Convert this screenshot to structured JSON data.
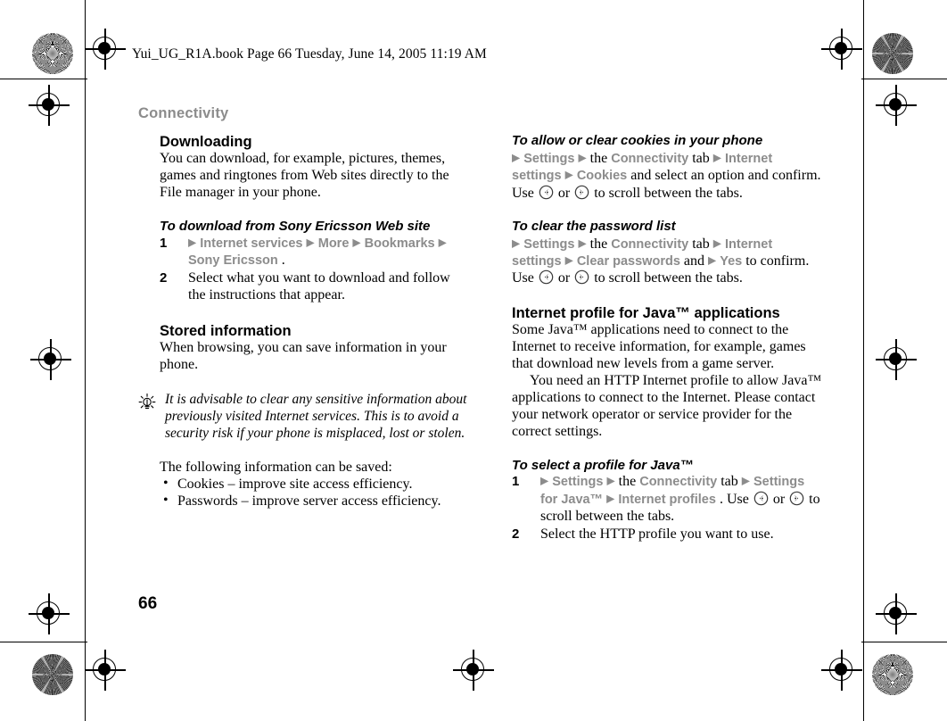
{
  "page": {
    "header_line": "Yui_UG_R1A.book  Page 66  Tuesday, June 14, 2005  11:19 AM",
    "chapter_title": "Connectivity",
    "page_number": "66",
    "gray_accent": "#8c8c8c",
    "arrow_glyph": "▶",
    "bullet_glyph": "•"
  },
  "left_column": {
    "downloading": {
      "heading": "Downloading",
      "body": "You can download, for example, pictures, themes, games and ringtones from Web sites directly to the File manager in your phone."
    },
    "download_sony": {
      "heading": "To download from Sony Ericsson Web site",
      "steps": [
        {
          "num": "1",
          "parts": [
            {
              "t": "arrow"
            },
            {
              "t": "menu",
              "v": "Internet services"
            },
            {
              "t": "arrow"
            },
            {
              "t": "menu",
              "v": "More"
            },
            {
              "t": "arrow"
            },
            {
              "t": "menu",
              "v": "Bookmarks"
            },
            {
              "t": "arrow"
            },
            {
              "t": "menu",
              "v": "Sony Ericsson"
            },
            {
              "t": "text",
              "v": "."
            }
          ]
        },
        {
          "num": "2",
          "parts": [
            {
              "t": "text",
              "v": "Select what you want to download and follow the instructions that appear."
            }
          ]
        }
      ]
    },
    "stored_information": {
      "heading": "Stored information",
      "body": "When browsing, you can save information in your phone.",
      "tip_icon": "lightbulb-icon",
      "tip": "It is advisable to clear any sensitive information about previously visited Internet services. This is to avoid a security risk if your phone is misplaced, lost or stolen.",
      "list_intro": "The following information can be saved:",
      "bullets": [
        "Cookies – improve site access efficiency.",
        "Passwords – improve server access efficiency."
      ]
    }
  },
  "right_column": {
    "cookies": {
      "heading": "To allow or clear cookies in your phone",
      "parts": [
        {
          "t": "arrow"
        },
        {
          "t": "menu",
          "v": "Settings"
        },
        {
          "t": "arrow"
        },
        {
          "t": "text",
          "v": "the"
        },
        {
          "t": "menu",
          "v": "Connectivity"
        },
        {
          "t": "text",
          "v": "tab"
        },
        {
          "t": "arrow"
        },
        {
          "t": "menu",
          "v": "Internet settings"
        },
        {
          "t": "arrow"
        },
        {
          "t": "menu",
          "v": "Cookies"
        },
        {
          "t": "text",
          "v": "and select an option and confirm. Use"
        },
        {
          "t": "navkey",
          "v": "nav-key-left-icon"
        },
        {
          "t": "text",
          "v": "or"
        },
        {
          "t": "navkey",
          "v": "nav-key-right-icon"
        },
        {
          "t": "text",
          "v": "to scroll between the tabs."
        }
      ]
    },
    "password_list": {
      "heading": "To clear the password list",
      "parts": [
        {
          "t": "arrow"
        },
        {
          "t": "menu",
          "v": "Settings"
        },
        {
          "t": "arrow"
        },
        {
          "t": "text",
          "v": "the"
        },
        {
          "t": "menu",
          "v": "Connectivity"
        },
        {
          "t": "text",
          "v": "tab"
        },
        {
          "t": "arrow"
        },
        {
          "t": "menu",
          "v": "Internet settings"
        },
        {
          "t": "arrow"
        },
        {
          "t": "menu",
          "v": "Clear passwords"
        },
        {
          "t": "text",
          "v": "and"
        },
        {
          "t": "arrow"
        },
        {
          "t": "menu",
          "v": "Yes"
        },
        {
          "t": "text",
          "v": "to confirm. Use"
        },
        {
          "t": "navkey",
          "v": "nav-key-left-icon"
        },
        {
          "t": "text",
          "v": "or"
        },
        {
          "t": "navkey",
          "v": "nav-key-right-icon"
        },
        {
          "t": "text",
          "v": "to scroll between the tabs."
        }
      ]
    },
    "java_profile": {
      "heading": "Internet profile for Java™ applications",
      "body1": "Some Java™ applications need to connect to the Internet to receive information, for example, games that download new levels from a game server.",
      "body2": "You need an HTTP Internet profile to allow Java™ applications to connect to the Internet. Please contact your network operator or service provider for the correct settings."
    },
    "select_java_profile": {
      "heading": "To select a profile for Java™",
      "steps": [
        {
          "num": "1",
          "parts": [
            {
              "t": "arrow"
            },
            {
              "t": "menu",
              "v": "Settings"
            },
            {
              "t": "arrow"
            },
            {
              "t": "text",
              "v": "the"
            },
            {
              "t": "menu",
              "v": "Connectivity"
            },
            {
              "t": "text",
              "v": "tab"
            },
            {
              "t": "arrow"
            },
            {
              "t": "menu",
              "v": "Settings for Java™"
            },
            {
              "t": "arrow"
            },
            {
              "t": "menu",
              "v": "Internet profiles"
            },
            {
              "t": "text",
              "v": ". Use"
            },
            {
              "t": "navkey",
              "v": "nav-key-left-icon"
            },
            {
              "t": "text",
              "v": "or"
            },
            {
              "t": "navkey",
              "v": "nav-key-right-icon"
            },
            {
              "t": "text",
              "v": "to scroll between the tabs."
            }
          ]
        },
        {
          "num": "2",
          "parts": [
            {
              "t": "text",
              "v": "Select the HTTP profile you want to use."
            }
          ]
        }
      ]
    }
  },
  "print_marks": {
    "targets": [
      {
        "name": "print-target-starburst-top-left",
        "style": "starburst"
      },
      {
        "name": "print-target-pinwheel-top-right",
        "style": "pinwheel"
      },
      {
        "name": "print-target-pinwheel-bottom-left",
        "style": "pinwheel"
      },
      {
        "name": "print-target-starburst-bottom-right",
        "style": "starburst"
      }
    ]
  }
}
